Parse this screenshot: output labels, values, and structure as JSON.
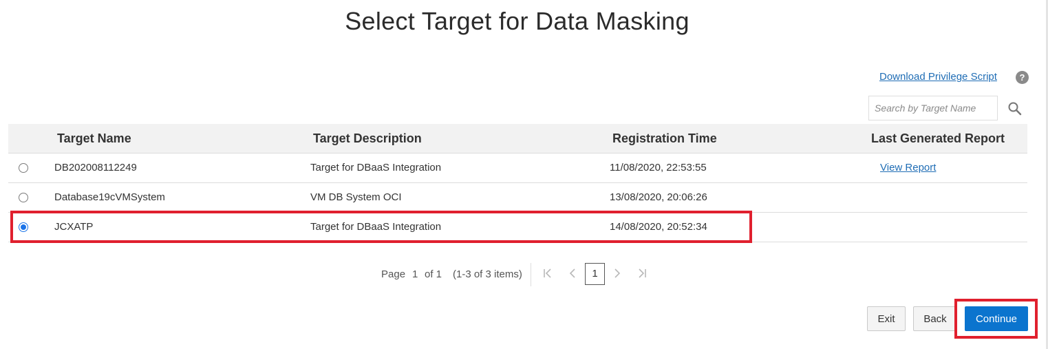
{
  "page_title": "Select Target for Data Masking",
  "toolbar": {
    "download_link": "Download Privilege Script",
    "help_icon": "help-icon",
    "help_glyph": "?",
    "search_placeholder": "Search by Target Name",
    "search_icon": "search-icon"
  },
  "table": {
    "columns": [
      "Target Name",
      "Target Description",
      "Registration Time",
      "Last Generated Report"
    ],
    "rows": [
      {
        "selected": false,
        "name": "DB202008112249",
        "description": "Target for DBaaS Integration",
        "time": "11/08/2020, 22:53:55",
        "report": "View Report"
      },
      {
        "selected": false,
        "name": "Database19cVMSystem",
        "description": "VM DB System OCI",
        "time": "13/08/2020, 20:06:26",
        "report": ""
      },
      {
        "selected": true,
        "name": "JCXATP",
        "description": "Target for DBaaS Integration",
        "time": "14/08/2020, 20:52:34",
        "report": ""
      }
    ]
  },
  "pagination": {
    "page_label": "Page",
    "current_page": "1",
    "of_label": "of 1",
    "range_label": "(1-3 of 3 items)",
    "page_button": "1"
  },
  "buttons": {
    "exit": "Exit",
    "back": "Back",
    "continue": "Continue"
  },
  "colors": {
    "primary": "#0b74ce",
    "link": "#1f6db5",
    "highlight": "#e0202e"
  }
}
